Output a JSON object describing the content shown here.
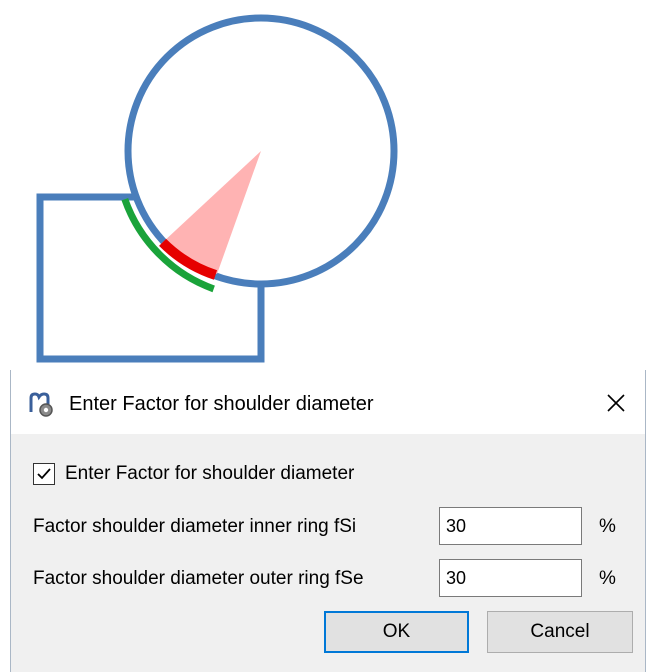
{
  "illustration": {
    "ring_color": "#4a7ebb",
    "housing_color": "#4a7ebb",
    "outer_arc_color": "#1aa33a",
    "inner_arc_color": "#e60000",
    "sector_color": "#ffb3b3"
  },
  "dialog": {
    "title": "Enter Factor for shoulder diameter",
    "app_icon": "gear-bearing-app-icon",
    "close_icon": "close-icon",
    "checkbox": {
      "label": "Enter Factor for shoulder diameter",
      "checked": true
    },
    "fields": [
      {
        "label": "Factor shoulder diameter inner ring  fSi",
        "value": "30",
        "unit": "%"
      },
      {
        "label": "Factor shoulder diameter outer ring  fSe",
        "value": "30",
        "unit": "%"
      }
    ],
    "buttons": {
      "ok": "OK",
      "cancel": "Cancel"
    },
    "accent_color": "#0078d7"
  }
}
